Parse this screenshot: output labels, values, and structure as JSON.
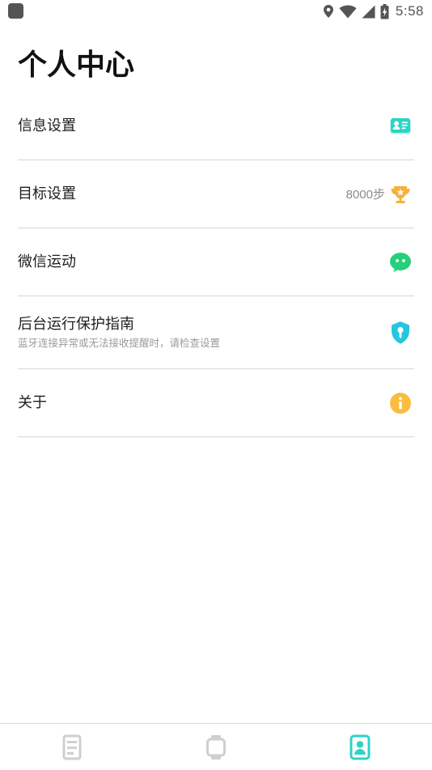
{
  "status_bar": {
    "time": "5:58",
    "icons": [
      "app-notification-icon",
      "location-icon",
      "wifi-icon",
      "signal-icon",
      "battery-charging-icon"
    ]
  },
  "header": {
    "title": "个人中心"
  },
  "menu": {
    "items": [
      {
        "label": "信息设置",
        "icon": "id-card-icon"
      },
      {
        "label": "目标设置",
        "value": "8000步",
        "icon": "trophy-icon"
      },
      {
        "label": "微信运动",
        "icon": "wechat-icon"
      },
      {
        "label": "后台运行保护指南",
        "sub": "蓝牙连接异常或无法接收提醒时，请检查设置",
        "icon": "shield-keyhole-icon"
      },
      {
        "label": "关于",
        "icon": "info-icon"
      }
    ]
  },
  "bottom_nav": {
    "tabs": [
      {
        "icon": "device-list-icon",
        "active": false
      },
      {
        "icon": "watch-icon",
        "active": false
      },
      {
        "icon": "profile-icon",
        "active": true
      }
    ]
  },
  "colors": {
    "accent_teal": "#2bd4c4",
    "wechat_green": "#25d07c",
    "trophy_orange": "#f8b03c",
    "info_yellow": "#fbbd3f",
    "shield_teal": "#26c6e0",
    "inactive_gray": "#cfcfcf"
  }
}
